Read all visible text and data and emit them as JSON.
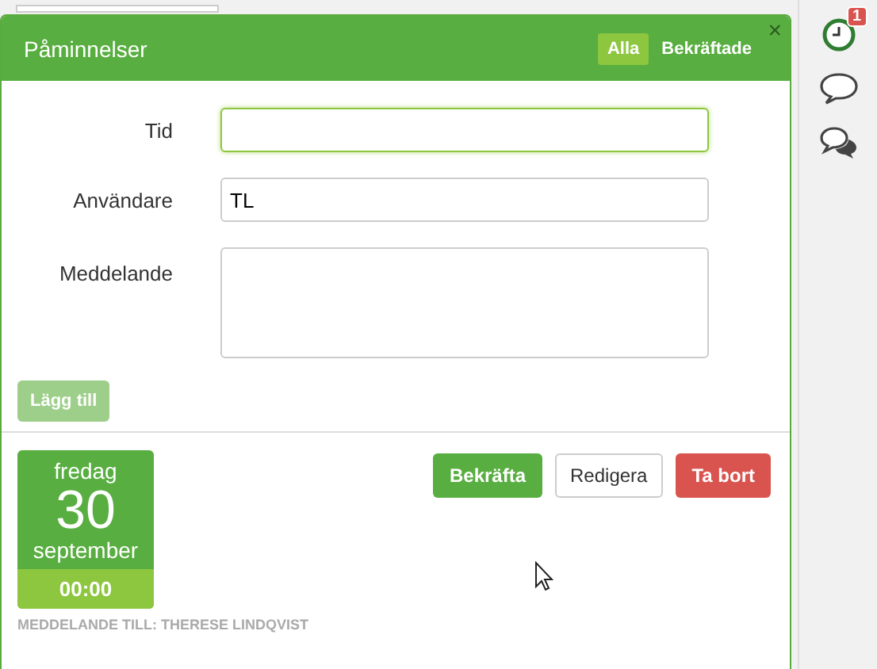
{
  "panel": {
    "title": "Påminnelser",
    "close": "×",
    "tabs": [
      {
        "label": "Alla",
        "selected": true
      },
      {
        "label": "Bekräftade",
        "selected": false
      }
    ]
  },
  "form": {
    "fields": [
      {
        "kind": "input",
        "label": "Tid",
        "focused": true
      },
      {
        "kind": "input",
        "label": "Användare",
        "value": "TL",
        "focused": false
      },
      {
        "kind": "textarea",
        "label": "Meddelande",
        "focused": false
      }
    ],
    "submit": {
      "label": "Lägg till",
      "disabled": true
    }
  },
  "reminders": [
    {
      "weekday": "fredag",
      "day": "30",
      "month": "september",
      "time": "00:00",
      "recipient": "MEDDELANDE TILL: THERESE LINDQVIST",
      "actions": [
        {
          "kind": "confirm",
          "label": "Bekräfta"
        },
        {
          "kind": "edit",
          "label": "Redigera"
        },
        {
          "kind": "delete",
          "label": "Ta bort"
        }
      ]
    }
  ],
  "sidebar": {
    "badge": "1"
  }
}
